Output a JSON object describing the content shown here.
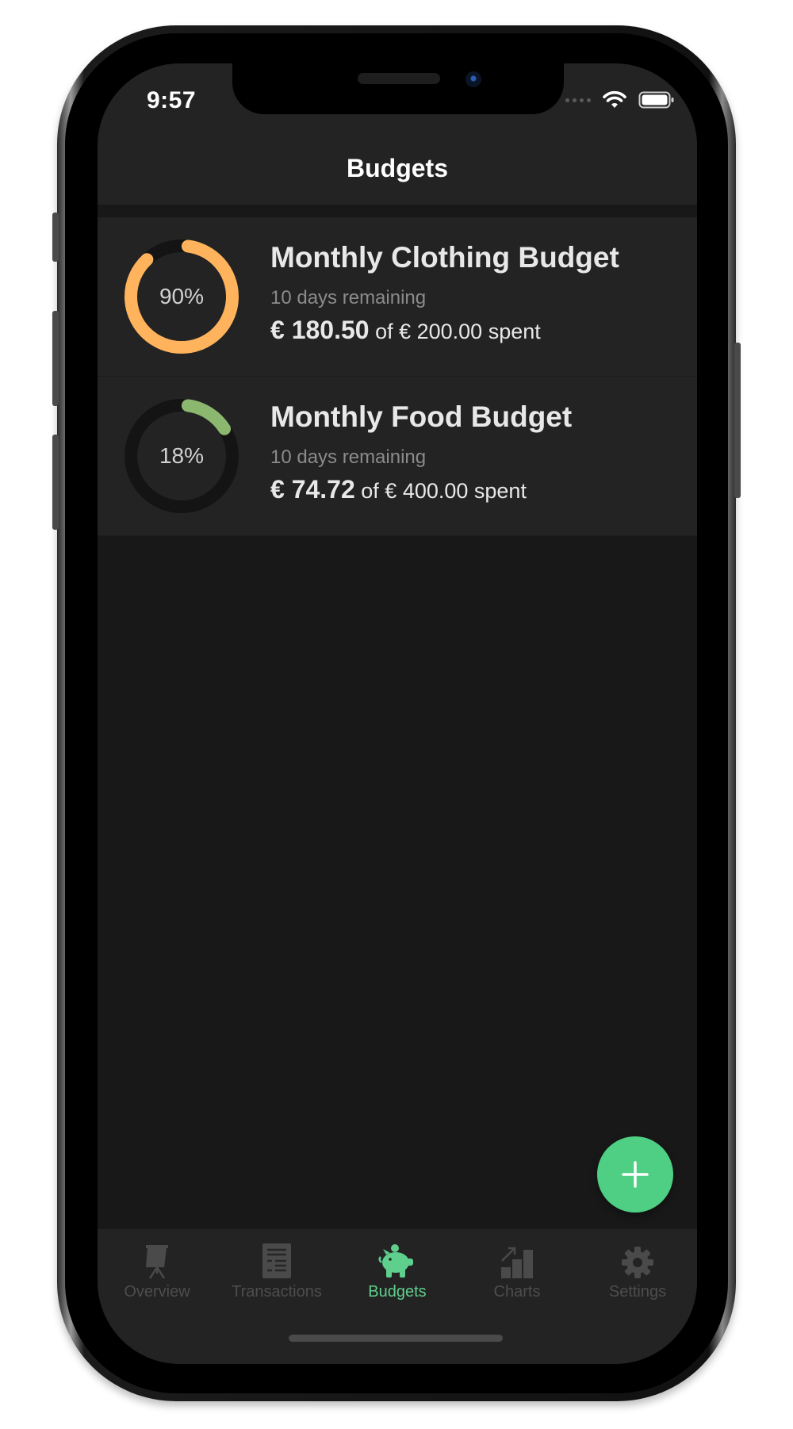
{
  "status_bar": {
    "time": "9:57"
  },
  "nav": {
    "title": "Budgets"
  },
  "budgets": [
    {
      "title": "Monthly Clothing Budget",
      "remaining": "10 days remaining",
      "spent": "€ 180.50",
      "total_text": "of € 200.00 spent",
      "percent_label": "90%",
      "progress": 0.9,
      "color": "#ffb35c"
    },
    {
      "title": "Monthly Food Budget",
      "remaining": "10 days remaining",
      "spent": "€ 74.72",
      "total_text": "of € 400.00 spent",
      "percent_label": "18%",
      "progress": 0.18,
      "color": "#8cb76e"
    }
  ],
  "fab": {
    "icon": "plus-icon"
  },
  "tabs": [
    {
      "label": "Overview",
      "icon": "presentation-icon",
      "active": false
    },
    {
      "label": "Transactions",
      "icon": "document-icon",
      "active": false
    },
    {
      "label": "Budgets",
      "icon": "piggy-bank-icon",
      "active": true
    },
    {
      "label": "Charts",
      "icon": "bar-chart-icon",
      "active": false
    },
    {
      "label": "Settings",
      "icon": "gear-icon",
      "active": false
    }
  ],
  "colors": {
    "accent": "#4fcf83",
    "background": "#181818",
    "surface": "#232323"
  }
}
